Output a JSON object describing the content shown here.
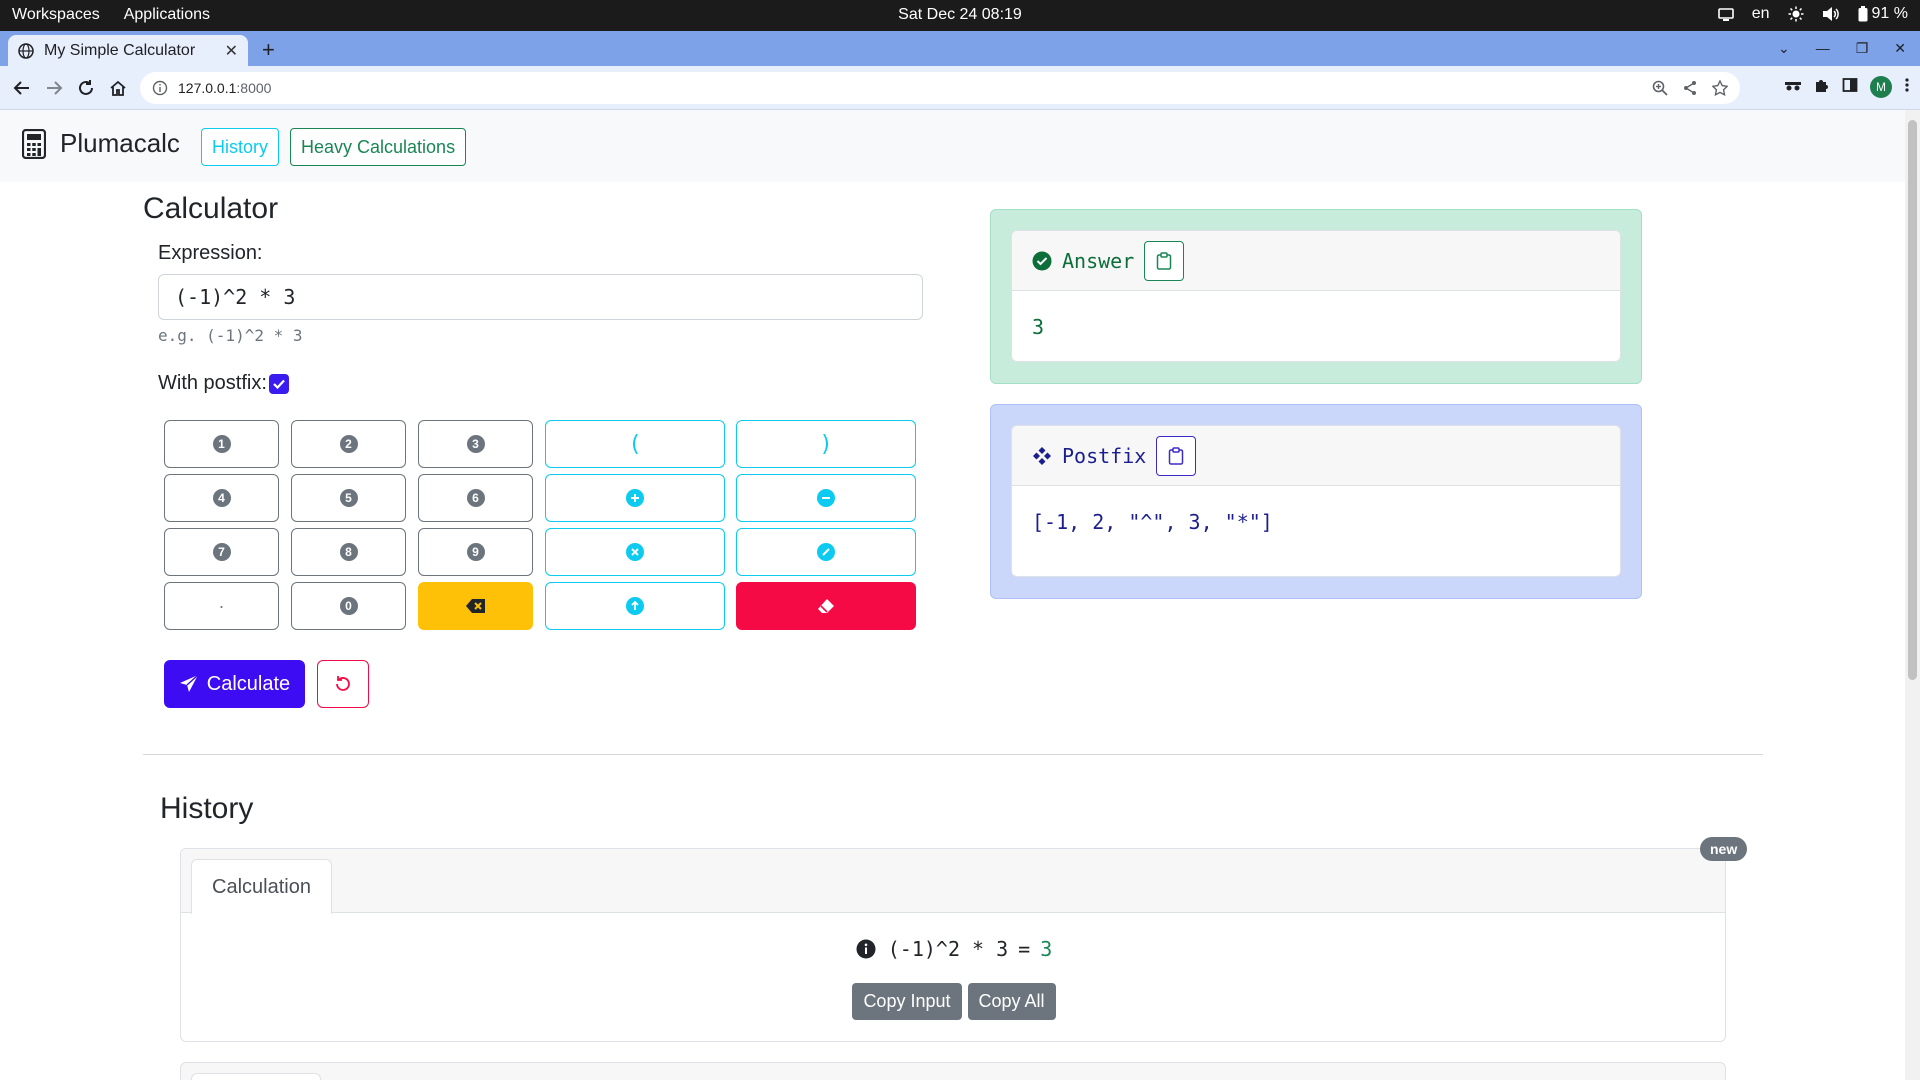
{
  "os": {
    "workspaces": "Workspaces",
    "applications": "Applications",
    "clock": "Sat Dec 24  08:19",
    "lang": "en",
    "battery": "91 %"
  },
  "browser": {
    "tab_title": "My Simple Calculator",
    "url_host": "127.0.0.1",
    "url_port": ":8000",
    "avatar_letter": "M"
  },
  "nav": {
    "brand": "Plumacalc",
    "history_link": "History",
    "heavy_link": "Heavy Calculations"
  },
  "calculator": {
    "title": "Calculator",
    "expression_label": "Expression:",
    "expression_value": "(-1)^2 * 3",
    "expression_hint": "e.g. (-1)^2 * 3",
    "postfix_label": "With postfix:",
    "postfix_checked": true,
    "keys": {
      "k1": "1",
      "k2": "2",
      "k3": "3",
      "k4": "4",
      "k5": "5",
      "k6": "6",
      "k7": "7",
      "k8": "8",
      "k9": "9",
      "kdot": "·",
      "k0": "0",
      "lparen": "(",
      "rparen": ")"
    },
    "calculate_label": "Calculate"
  },
  "answer": {
    "title": "Answer",
    "value": "3"
  },
  "postfix": {
    "title": "Postfix",
    "value": "[-1, 2, \"^\", 3, \"*\"]"
  },
  "history": {
    "title": "History",
    "badge": "new",
    "tab_label": "Calculation",
    "expression": "(-1)^2 * 3",
    "equals": "=",
    "result": "3",
    "copy_input": "Copy Input",
    "copy_all": "Copy All"
  },
  "colors": {
    "primary": "#3d0cf2",
    "info": "#0dcaf0",
    "success": "#198754",
    "warning": "#ffc107",
    "danger": "#f50a46",
    "secondary": "#6c757d"
  }
}
